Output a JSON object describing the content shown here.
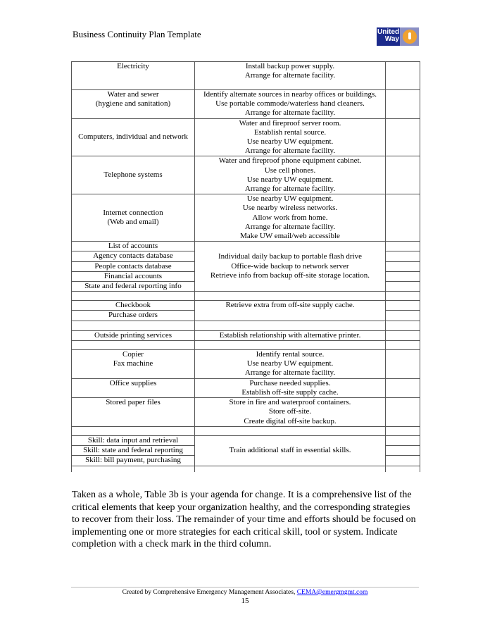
{
  "header": {
    "title": "Business Continuity Plan Template",
    "logo_text": [
      "United",
      "Way"
    ]
  },
  "table": {
    "r1": {
      "item": [
        "Electricity"
      ],
      "strategy": [
        "Install backup power supply.",
        "Arrange for alternate facility."
      ]
    },
    "r2": {
      "item": [
        "Water and sewer",
        "(hygiene and sanitation)"
      ],
      "strategy": [
        "Identify alternate sources in nearby offices or buildings.",
        "Use portable commode/waterless hand cleaners.",
        "Arrange for alternate facility."
      ]
    },
    "r3": {
      "item": [
        "Computers, individual and network"
      ],
      "strategy": [
        "Water and fireproof server room.",
        "Establish rental source.",
        "Use nearby UW equipment.",
        "Arrange for alternate facility."
      ]
    },
    "r4": {
      "item": [
        "Telephone systems"
      ],
      "strategy": [
        "Water and fireproof phone equipment cabinet.",
        "Use cell phones.",
        "Use nearby UW equipment.",
        "Arrange for alternate facility."
      ]
    },
    "r5": {
      "item": [
        "Internet connection",
        "(Web and email)"
      ],
      "strategy": [
        "Use nearby UW equipment.",
        "Use nearby wireless networks.",
        "Allow work from home.",
        "Arrange for alternate facility.",
        "Make UW email/web accessible"
      ]
    },
    "data_items": [
      "List of accounts",
      "Agency contacts database",
      "People contacts database",
      "Financial accounts",
      "State and federal reporting info"
    ],
    "data_strategy": [
      "Individual daily backup to portable flash drive",
      "Office-wide backup to network server",
      "Retrieve info from backup off-site storage location."
    ],
    "supply_items": [
      "Checkbook",
      "Purchase orders"
    ],
    "supply_strategy": "Retrieve extra from off-site supply cache.",
    "printing": {
      "item": "Outside printing services",
      "strategy": "Establish relationship with alternative printer."
    },
    "copier": {
      "item": [
        "Copier",
        "Fax machine"
      ],
      "strategy": [
        "Identify rental source.",
        "Use nearby UW equipment.",
        "Arrange for alternate facility."
      ]
    },
    "office": {
      "item": "Office supplies",
      "strategy": [
        "Purchase needed supplies.",
        "Establish off-site supply cache."
      ]
    },
    "paper": {
      "item": "Stored paper files",
      "strategy": [
        "Store in fire and waterproof containers.",
        "Store off-site.",
        "Create digital off-site backup."
      ]
    },
    "skills": [
      "Skill:  data input and retrieval",
      "Skill:  state and federal reporting",
      "Skill:  bill payment, purchasing"
    ],
    "skills_strategy": "Train additional staff in essential skills."
  },
  "paragraph": "Taken as a whole, Table 3b is your agenda for change.  It is a comprehensive list of the critical elements that keep your organization healthy, and the corresponding strategies to recover from their loss.  The remainder of your time and efforts should be focused on implementing one or more strategies for each critical skill, tool or system.  Indicate completion with a check mark in the third column.",
  "footer": {
    "text": "Created by Comprehensive Emergency Management Associates, ",
    "email": "CEMA@emergmgmt.com",
    "page": "15"
  }
}
